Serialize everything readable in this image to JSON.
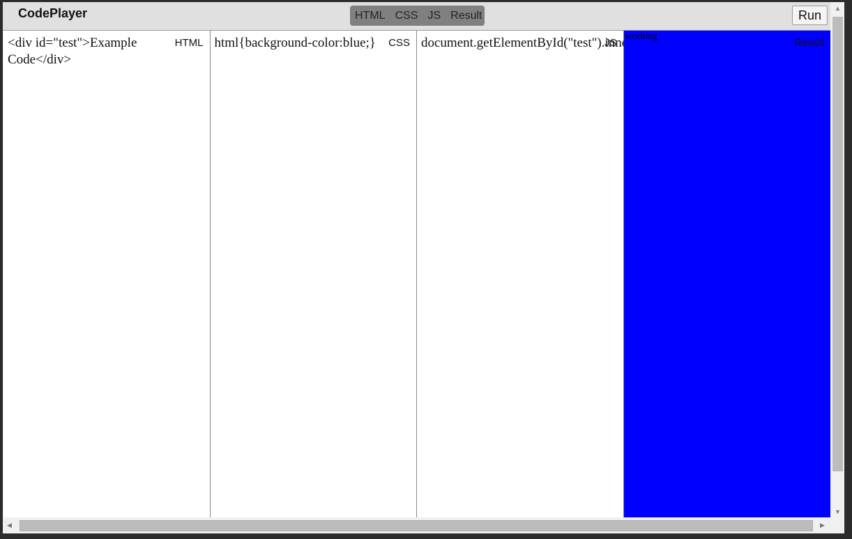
{
  "header": {
    "title": "CodePlayer",
    "toggles": [
      "HTML",
      "CSS",
      "JS",
      "Result"
    ],
    "run_label": "Run"
  },
  "panels": {
    "html": {
      "label": "HTML",
      "code": "<div id=\"test\">Example Code</div>"
    },
    "css": {
      "label": "CSS",
      "code": "html{background-color:blue;}"
    },
    "js": {
      "label": "JS",
      "code": "document.getElementById(\"test\").innerHTML=\"working\";"
    },
    "result": {
      "label": "Result",
      "output": "working",
      "background": "#0000ff"
    }
  }
}
